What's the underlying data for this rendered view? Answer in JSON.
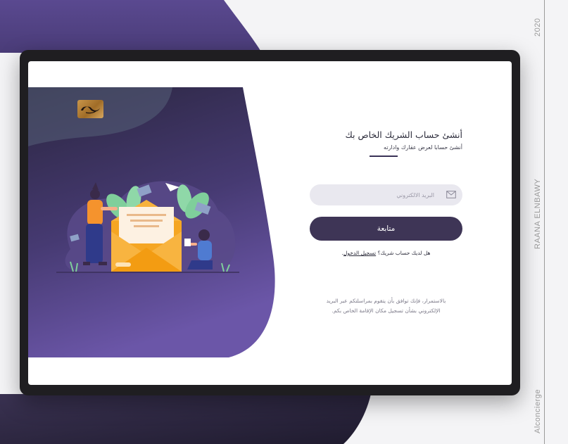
{
  "side_labels": {
    "year": "2020",
    "designer": "RAANA ELNBAWY",
    "project": "Alconcierge"
  },
  "form": {
    "title": "أنشئ حساب الشريك الخاص بك",
    "subtitle": "أنشئ حسابا لعرض عقارك وادارته",
    "email_placeholder": "البريد الالكتروني",
    "email_value": "",
    "continue_label": "متابعة",
    "login_question": "هل لديك حساب شريك؟",
    "login_link": "تسجيل الدخول",
    "terms_line1": "بالاستمرار، فإنك توافق بأن يتقوم بمراسلتكم عبر البريد",
    "terms_line2": "الإلكتروني بشأن تسجيل مكان الإقامة الخاص بكم."
  },
  "icons": {
    "logo": "alconcierge-logo",
    "email_field_icon": "envelope-icon",
    "illustration": "envelope-with-people-illustration"
  },
  "colors": {
    "primary": "#3e3556",
    "hero_gradient_top": "#2f2a42",
    "hero_gradient_bottom": "#6a55a5",
    "background_purple": "#5d4b91",
    "envelope": "#f5a623",
    "input_background": "#e9e8ef"
  }
}
